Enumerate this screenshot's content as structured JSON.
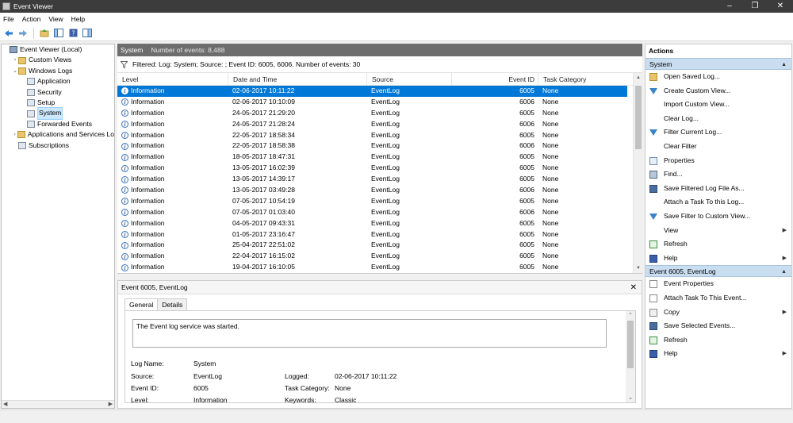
{
  "window": {
    "title": "Event Viewer"
  },
  "menu": [
    "File",
    "Action",
    "View",
    "Help"
  ],
  "tree": {
    "items": [
      {
        "label": "Event Viewer (Local)",
        "level": 0,
        "expander": "",
        "icon": "computer-icon"
      },
      {
        "label": "Custom Views",
        "level": 1,
        "expander": "›",
        "icon": "folder-icon"
      },
      {
        "label": "Windows Logs",
        "level": 1,
        "expander": "⌄",
        "icon": "folder-icon"
      },
      {
        "label": "Application",
        "level": 2,
        "expander": "",
        "icon": "log-icon"
      },
      {
        "label": "Security",
        "level": 2,
        "expander": "",
        "icon": "log-icon"
      },
      {
        "label": "Setup",
        "level": 2,
        "expander": "",
        "icon": "log-icon"
      },
      {
        "label": "System",
        "level": 2,
        "expander": "",
        "icon": "log-icon",
        "selected": true
      },
      {
        "label": "Forwarded Events",
        "level": 2,
        "expander": "",
        "icon": "log-icon"
      },
      {
        "label": "Applications and Services Lo",
        "level": 1,
        "expander": "›",
        "icon": "folder-icon"
      },
      {
        "label": "Subscriptions",
        "level": 1,
        "expander": "",
        "icon": "log-icon"
      }
    ]
  },
  "center": {
    "title": "System",
    "count": "Number of events: 8,488",
    "filter": "Filtered: Log: System; Source: ; Event ID: 6005, 6006. Number of events: 30",
    "columns": {
      "level": "Level",
      "date": "Date and Time",
      "source": "Source",
      "event": "Event ID",
      "task": "Task Category"
    },
    "rows": [
      {
        "level": "Information",
        "date": "02-06-2017 10:11:22",
        "source": "EventLog",
        "event": "6005",
        "task": "None"
      },
      {
        "level": "Information",
        "date": "02-06-2017 10:10:09",
        "source": "EventLog",
        "event": "6006",
        "task": "None"
      },
      {
        "level": "Information",
        "date": "24-05-2017 21:29:20",
        "source": "EventLog",
        "event": "6005",
        "task": "None"
      },
      {
        "level": "Information",
        "date": "24-05-2017 21:28:24",
        "source": "EventLog",
        "event": "6006",
        "task": "None"
      },
      {
        "level": "Information",
        "date": "22-05-2017 18:58:34",
        "source": "EventLog",
        "event": "6005",
        "task": "None"
      },
      {
        "level": "Information",
        "date": "22-05-2017 18:58:38",
        "source": "EventLog",
        "event": "6006",
        "task": "None"
      },
      {
        "level": "Information",
        "date": "18-05-2017 18:47:31",
        "source": "EventLog",
        "event": "6005",
        "task": "None"
      },
      {
        "level": "Information",
        "date": "13-05-2017 16:02:39",
        "source": "EventLog",
        "event": "6005",
        "task": "None"
      },
      {
        "level": "Information",
        "date": "13-05-2017 14:39:17",
        "source": "EventLog",
        "event": "6005",
        "task": "None"
      },
      {
        "level": "Information",
        "date": "13-05-2017 03:49:28",
        "source": "EventLog",
        "event": "6006",
        "task": "None"
      },
      {
        "level": "Information",
        "date": "07-05-2017 10:54:19",
        "source": "EventLog",
        "event": "6005",
        "task": "None"
      },
      {
        "level": "Information",
        "date": "07-05-2017 01:03:40",
        "source": "EventLog",
        "event": "6006",
        "task": "None"
      },
      {
        "level": "Information",
        "date": "04-05-2017 09:43:31",
        "source": "EventLog",
        "event": "6005",
        "task": "None"
      },
      {
        "level": "Information",
        "date": "01-05-2017 23:16:47",
        "source": "EventLog",
        "event": "6005",
        "task": "None"
      },
      {
        "level": "Information",
        "date": "25-04-2017 22:51:02",
        "source": "EventLog",
        "event": "6005",
        "task": "None"
      },
      {
        "level": "Information",
        "date": "22-04-2017 16:15:02",
        "source": "EventLog",
        "event": "6005",
        "task": "None"
      },
      {
        "level": "Information",
        "date": "19-04-2017 16:10:05",
        "source": "EventLog",
        "event": "6005",
        "task": "None"
      }
    ]
  },
  "detail": {
    "title": "Event 6005, EventLog",
    "tabs": [
      "General",
      "Details"
    ],
    "message": "The Event log service was started.",
    "log_name_label": "Log Name:",
    "log_name": "System",
    "source_label": "Source:",
    "source": "EventLog",
    "logged_label": "Logged:",
    "logged": "02-06-2017 10:11:22",
    "event_id_label": "Event ID:",
    "event_id": "6005",
    "task_label": "Task Category:",
    "task": "None",
    "level_label": "Level:",
    "level": "Information",
    "keywords_label": "Keywords:",
    "keywords": "Classic"
  },
  "actions": {
    "title": "Actions",
    "section1": {
      "title": "System",
      "items": [
        {
          "label": "Open Saved Log...",
          "icon": "folder-open-icon",
          "cls": "ai-folder",
          "sub": false
        },
        {
          "label": "Create Custom View...",
          "icon": "filter-icon",
          "cls": "ai-filter",
          "sub": false
        },
        {
          "label": "Import Custom View...",
          "icon": "",
          "cls": "",
          "sub": false
        },
        {
          "label": "Clear Log...",
          "icon": "",
          "cls": "",
          "sub": false
        },
        {
          "label": "Filter Current Log...",
          "icon": "filter-icon",
          "cls": "ai-filter",
          "sub": false
        },
        {
          "label": "Clear Filter",
          "icon": "",
          "cls": "",
          "sub": false
        },
        {
          "label": "Properties",
          "icon": "properties-icon",
          "cls": "ai-props",
          "sub": false
        },
        {
          "label": "Find...",
          "icon": "find-icon",
          "cls": "ai-find",
          "sub": false
        },
        {
          "label": "Save Filtered Log File As...",
          "icon": "save-icon",
          "cls": "ai-save",
          "sub": false
        },
        {
          "label": "Attach a Task To this Log...",
          "icon": "",
          "cls": "",
          "sub": false
        },
        {
          "label": "Save Filter to Custom View...",
          "icon": "filter-save-icon",
          "cls": "ai-filter",
          "sub": false
        },
        {
          "label": "View",
          "icon": "",
          "cls": "",
          "sub": true
        },
        {
          "label": "Refresh",
          "icon": "refresh-icon",
          "cls": "ai-refresh",
          "sub": false
        },
        {
          "label": "Help",
          "icon": "help-icon",
          "cls": "ai-help",
          "sub": true
        }
      ]
    },
    "section2": {
      "title": "Event 6005, EventLog",
      "items": [
        {
          "label": "Event Properties",
          "icon": "event-properties-icon",
          "cls": "ai-page",
          "sub": false
        },
        {
          "label": "Attach Task To This Event...",
          "icon": "attach-task-icon",
          "cls": "ai-page",
          "sub": false
        },
        {
          "label": "Copy",
          "icon": "copy-icon",
          "cls": "ai-copy",
          "sub": true
        },
        {
          "label": "Save Selected Events...",
          "icon": "save-icon",
          "cls": "ai-save",
          "sub": false
        },
        {
          "label": "Refresh",
          "icon": "refresh-icon",
          "cls": "ai-refresh",
          "sub": false
        },
        {
          "label": "Help",
          "icon": "help-icon",
          "cls": "ai-help",
          "sub": true
        }
      ]
    }
  },
  "colors": {
    "selection": "#0078d7",
    "section_header": "#c9ddf0",
    "header_bar": "#6d6d6d"
  }
}
